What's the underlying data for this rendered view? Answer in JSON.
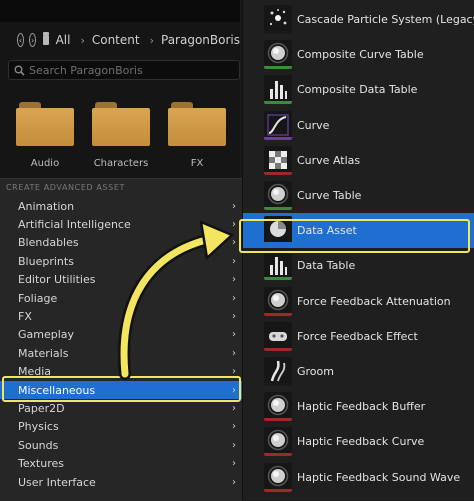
{
  "breadcrumb": {
    "items": [
      "All",
      "Content",
      "ParagonBoris"
    ]
  },
  "search": {
    "placeholder": "Search ParagonBoris"
  },
  "folders": [
    {
      "label": "Audio"
    },
    {
      "label": "Characters"
    },
    {
      "label": "FX"
    }
  ],
  "menu": {
    "section_title": "CREATE ADVANCED ASSET",
    "categories": [
      {
        "label": "Animation",
        "has_submenu": true
      },
      {
        "label": "Artificial Intelligence",
        "has_submenu": true
      },
      {
        "label": "Blendables",
        "has_submenu": true
      },
      {
        "label": "Blueprints",
        "has_submenu": true
      },
      {
        "label": "Editor Utilities",
        "has_submenu": true
      },
      {
        "label": "Foliage",
        "has_submenu": true
      },
      {
        "label": "FX",
        "has_submenu": true
      },
      {
        "label": "Gameplay",
        "has_submenu": true
      },
      {
        "label": "Materials",
        "has_submenu": true
      },
      {
        "label": "Media",
        "has_submenu": true
      },
      {
        "label": "Miscellaneous",
        "has_submenu": true,
        "selected": true
      },
      {
        "label": "Paper2D",
        "has_submenu": true
      },
      {
        "label": "Physics",
        "has_submenu": true
      },
      {
        "label": "Sounds",
        "has_submenu": true
      },
      {
        "label": "Textures",
        "has_submenu": true
      },
      {
        "label": "User Interface",
        "has_submenu": true
      }
    ]
  },
  "submenu": {
    "items": [
      {
        "label": "Cascade Particle System (Legacy)",
        "icon": "particle-icon",
        "accent": "#1a1a1a"
      },
      {
        "label": "Composite Curve Table",
        "icon": "sphere-icon",
        "accent": "#3d8a3d"
      },
      {
        "label": "Composite Data Table",
        "icon": "bar-chart-icon",
        "accent": "#3d8a3d"
      },
      {
        "label": "Curve",
        "icon": "curve-icon",
        "accent": "#6b3fa0"
      },
      {
        "label": "Curve Atlas",
        "icon": "checker-icon",
        "accent": "#9a2a2a"
      },
      {
        "label": "Curve Table",
        "icon": "sphere-icon",
        "accent": "#3d8a3d"
      },
      {
        "label": "Data Asset",
        "icon": "pie-icon",
        "accent": "#1f6fd1",
        "selected": true
      },
      {
        "label": "Data Table",
        "icon": "bar-chart-icon",
        "accent": "#3d8a3d"
      },
      {
        "label": "Force Feedback Attenuation",
        "icon": "sphere-icon",
        "accent": "#a02828"
      },
      {
        "label": "Force Feedback Effect",
        "icon": "gamepad-icon",
        "accent": "#a02828"
      },
      {
        "label": "Groom",
        "icon": "groom-icon",
        "accent": "#1a1a1a"
      },
      {
        "label": "Haptic Feedback Buffer",
        "icon": "sphere-icon",
        "accent": "#a02828"
      },
      {
        "label": "Haptic Feedback Curve",
        "icon": "sphere-icon",
        "accent": "#a02828"
      },
      {
        "label": "Haptic Feedback Sound Wave",
        "icon": "sphere-icon",
        "accent": "#a02828"
      }
    ]
  },
  "colors": {
    "selection": "#1f6fd1",
    "highlight": "#f2e55f",
    "folder": "#d9a553"
  }
}
